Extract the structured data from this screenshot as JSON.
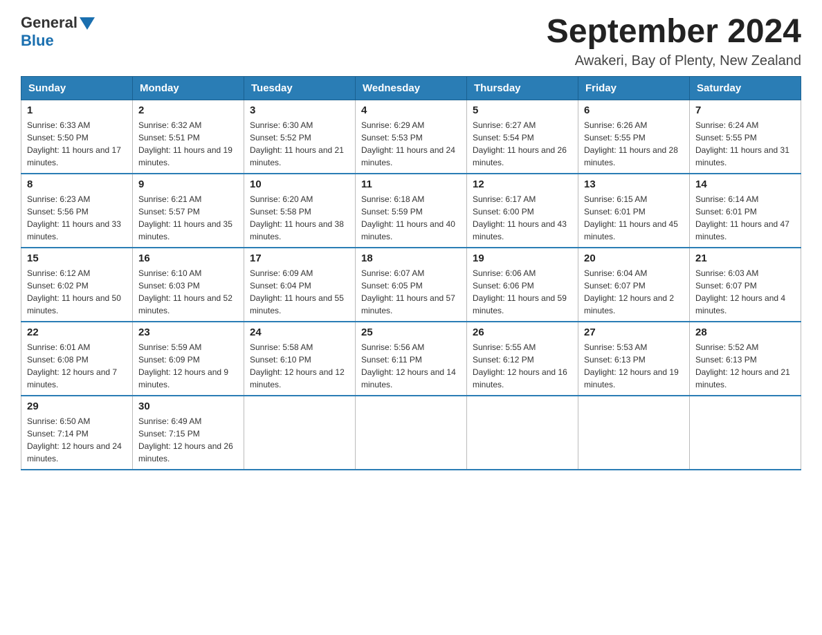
{
  "header": {
    "logo_text1": "General",
    "logo_text2": "Blue",
    "title": "September 2024",
    "subtitle": "Awakeri, Bay of Plenty, New Zealand"
  },
  "weekdays": [
    "Sunday",
    "Monday",
    "Tuesday",
    "Wednesday",
    "Thursday",
    "Friday",
    "Saturday"
  ],
  "weeks": [
    [
      {
        "day": "1",
        "sunrise": "6:33 AM",
        "sunset": "5:50 PM",
        "daylight": "11 hours and 17 minutes."
      },
      {
        "day": "2",
        "sunrise": "6:32 AM",
        "sunset": "5:51 PM",
        "daylight": "11 hours and 19 minutes."
      },
      {
        "day": "3",
        "sunrise": "6:30 AM",
        "sunset": "5:52 PM",
        "daylight": "11 hours and 21 minutes."
      },
      {
        "day": "4",
        "sunrise": "6:29 AM",
        "sunset": "5:53 PM",
        "daylight": "11 hours and 24 minutes."
      },
      {
        "day": "5",
        "sunrise": "6:27 AM",
        "sunset": "5:54 PM",
        "daylight": "11 hours and 26 minutes."
      },
      {
        "day": "6",
        "sunrise": "6:26 AM",
        "sunset": "5:55 PM",
        "daylight": "11 hours and 28 minutes."
      },
      {
        "day": "7",
        "sunrise": "6:24 AM",
        "sunset": "5:55 PM",
        "daylight": "11 hours and 31 minutes."
      }
    ],
    [
      {
        "day": "8",
        "sunrise": "6:23 AM",
        "sunset": "5:56 PM",
        "daylight": "11 hours and 33 minutes."
      },
      {
        "day": "9",
        "sunrise": "6:21 AM",
        "sunset": "5:57 PM",
        "daylight": "11 hours and 35 minutes."
      },
      {
        "day": "10",
        "sunrise": "6:20 AM",
        "sunset": "5:58 PM",
        "daylight": "11 hours and 38 minutes."
      },
      {
        "day": "11",
        "sunrise": "6:18 AM",
        "sunset": "5:59 PM",
        "daylight": "11 hours and 40 minutes."
      },
      {
        "day": "12",
        "sunrise": "6:17 AM",
        "sunset": "6:00 PM",
        "daylight": "11 hours and 43 minutes."
      },
      {
        "day": "13",
        "sunrise": "6:15 AM",
        "sunset": "6:01 PM",
        "daylight": "11 hours and 45 minutes."
      },
      {
        "day": "14",
        "sunrise": "6:14 AM",
        "sunset": "6:01 PM",
        "daylight": "11 hours and 47 minutes."
      }
    ],
    [
      {
        "day": "15",
        "sunrise": "6:12 AM",
        "sunset": "6:02 PM",
        "daylight": "11 hours and 50 minutes."
      },
      {
        "day": "16",
        "sunrise": "6:10 AM",
        "sunset": "6:03 PM",
        "daylight": "11 hours and 52 minutes."
      },
      {
        "day": "17",
        "sunrise": "6:09 AM",
        "sunset": "6:04 PM",
        "daylight": "11 hours and 55 minutes."
      },
      {
        "day": "18",
        "sunrise": "6:07 AM",
        "sunset": "6:05 PM",
        "daylight": "11 hours and 57 minutes."
      },
      {
        "day": "19",
        "sunrise": "6:06 AM",
        "sunset": "6:06 PM",
        "daylight": "11 hours and 59 minutes."
      },
      {
        "day": "20",
        "sunrise": "6:04 AM",
        "sunset": "6:07 PM",
        "daylight": "12 hours and 2 minutes."
      },
      {
        "day": "21",
        "sunrise": "6:03 AM",
        "sunset": "6:07 PM",
        "daylight": "12 hours and 4 minutes."
      }
    ],
    [
      {
        "day": "22",
        "sunrise": "6:01 AM",
        "sunset": "6:08 PM",
        "daylight": "12 hours and 7 minutes."
      },
      {
        "day": "23",
        "sunrise": "5:59 AM",
        "sunset": "6:09 PM",
        "daylight": "12 hours and 9 minutes."
      },
      {
        "day": "24",
        "sunrise": "5:58 AM",
        "sunset": "6:10 PM",
        "daylight": "12 hours and 12 minutes."
      },
      {
        "day": "25",
        "sunrise": "5:56 AM",
        "sunset": "6:11 PM",
        "daylight": "12 hours and 14 minutes."
      },
      {
        "day": "26",
        "sunrise": "5:55 AM",
        "sunset": "6:12 PM",
        "daylight": "12 hours and 16 minutes."
      },
      {
        "day": "27",
        "sunrise": "5:53 AM",
        "sunset": "6:13 PM",
        "daylight": "12 hours and 19 minutes."
      },
      {
        "day": "28",
        "sunrise": "5:52 AM",
        "sunset": "6:13 PM",
        "daylight": "12 hours and 21 minutes."
      }
    ],
    [
      {
        "day": "29",
        "sunrise": "6:50 AM",
        "sunset": "7:14 PM",
        "daylight": "12 hours and 24 minutes."
      },
      {
        "day": "30",
        "sunrise": "6:49 AM",
        "sunset": "7:15 PM",
        "daylight": "12 hours and 26 minutes."
      },
      null,
      null,
      null,
      null,
      null
    ]
  ]
}
